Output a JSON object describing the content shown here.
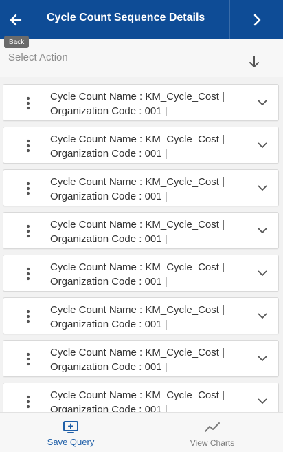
{
  "header": {
    "title": "Cycle Count Sequence Details",
    "back_tooltip": "Back",
    "back_icon": "arrow-left-icon",
    "next_icon": "chevron-right-icon"
  },
  "action": {
    "placeholder": "Select Action",
    "sort_icon": "arrow-down-icon"
  },
  "records": [
    {
      "line1": "Cycle Count Name : KM_Cycle_Cost |",
      "line2": "Organization Code : 001 |"
    },
    {
      "line1": "Cycle Count Name : KM_Cycle_Cost |",
      "line2": "Organization Code : 001 |"
    },
    {
      "line1": "Cycle Count Name : KM_Cycle_Cost |",
      "line2": "Organization Code : 001 |"
    },
    {
      "line1": "Cycle Count Name : KM_Cycle_Cost |",
      "line2": "Organization Code : 001 |"
    },
    {
      "line1": "Cycle Count Name : KM_Cycle_Cost |",
      "line2": "Organization Code : 001 |"
    },
    {
      "line1": "Cycle Count Name : KM_Cycle_Cost |",
      "line2": "Organization Code : 001 |"
    },
    {
      "line1": "Cycle Count Name : KM_Cycle_Cost |",
      "line2": "Organization Code : 001 |"
    },
    {
      "line1": "Cycle Count Name : KM_Cycle_Cost |",
      "line2": "Organization Code : 001 |"
    }
  ],
  "bottom_bar": {
    "save_query_label": "Save Query",
    "view_charts_label": "View Charts",
    "save_query_icon": "monitor-plus-icon",
    "view_charts_icon": "trend-line-icon"
  },
  "colors": {
    "header_bg": "#0e4c96",
    "accent": "#1f5fa8",
    "muted": "#8d8d8d"
  }
}
